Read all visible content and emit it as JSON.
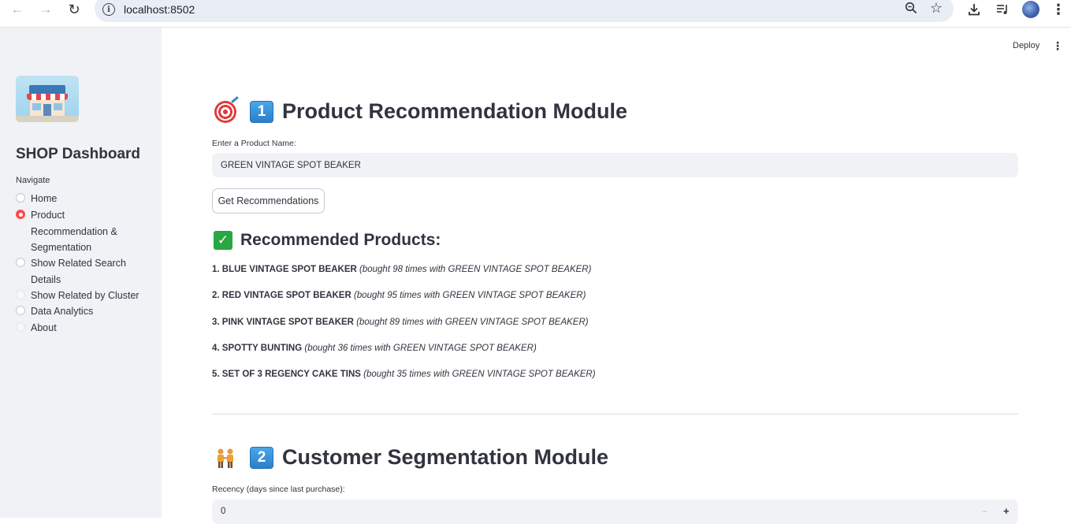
{
  "browser": {
    "url": "localhost:8502"
  },
  "sidebar": {
    "title": "SHOP Dashboard",
    "nav_label": "Navigate",
    "items": [
      {
        "label": "Home",
        "selected": false
      },
      {
        "label": "Product Recommendation & Segmentation",
        "selected": true
      },
      {
        "label": "Show Related Search Details",
        "selected": false
      },
      {
        "label": "Show Related by Cluster",
        "selected": false
      },
      {
        "label": "Data Analytics",
        "selected": false
      },
      {
        "label": "About",
        "selected": false
      }
    ]
  },
  "header": {
    "deploy_label": "Deploy",
    "menu_icon": "kebab-menu-icon"
  },
  "module1": {
    "keycap": "1",
    "title": "Product Recommendation Module",
    "input_label": "Enter a Product Name:",
    "input_value": "GREEN VINTAGE SPOT BEAKER",
    "button_label": "Get Recommendations",
    "results_title": "Recommended Products:",
    "results": [
      {
        "name": "1. BLUE VINTAGE SPOT BEAKER",
        "detail": "(bought 98 times with GREEN VINTAGE SPOT BEAKER)"
      },
      {
        "name": "2. RED VINTAGE SPOT BEAKER",
        "detail": "(bought 95 times with GREEN VINTAGE SPOT BEAKER)"
      },
      {
        "name": "3. PINK VINTAGE SPOT BEAKER",
        "detail": "(bought 89 times with GREEN VINTAGE SPOT BEAKER)"
      },
      {
        "name": "4. SPOTTY BUNTING",
        "detail": "(bought 36 times with GREEN VINTAGE SPOT BEAKER)"
      },
      {
        "name": "5. SET OF 3 REGENCY CAKE TINS",
        "detail": "(bought 35 times with GREEN VINTAGE SPOT BEAKER)"
      }
    ]
  },
  "module2": {
    "keycap": "2",
    "title": "Customer Segmentation Module",
    "recency_label": "Recency (days since last purchase):",
    "recency_value": "0",
    "minus_label": "−",
    "plus_label": "+"
  },
  "colors": {
    "accent": "#ff4b4b",
    "sidebar_bg": "#f0f2f6",
    "text": "#31333f",
    "check": "#28a745",
    "keycap": "#2b7fc9"
  }
}
